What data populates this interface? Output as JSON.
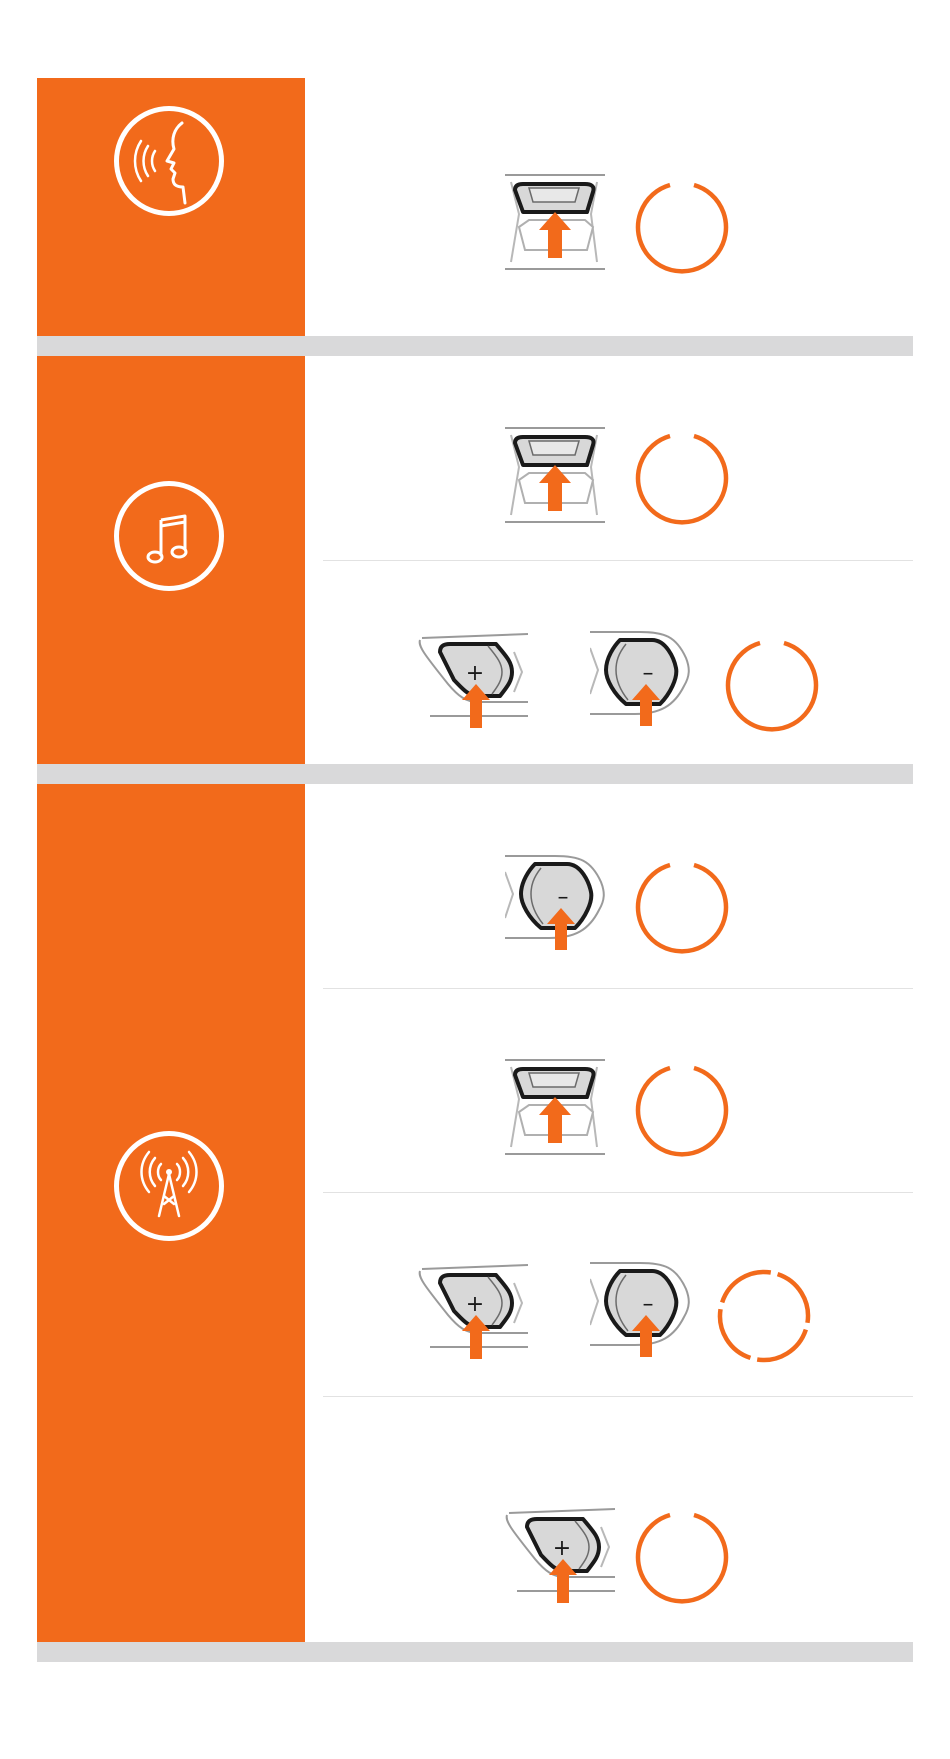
{
  "colors": {
    "accent": "#f26a1b",
    "separator": "#d9d9da",
    "divider": "#e2e2e2",
    "button_fill": "#d8d8d8",
    "button_stroke": "#1a1a1a"
  },
  "sections": [
    {
      "icon": "voice-command-icon",
      "rows": [
        {
          "buttons": [
            {
              "type": "center",
              "glyph": ""
            }
          ],
          "indicator": "solid-ring"
        }
      ]
    },
    {
      "icon": "music-note-icon",
      "rows": [
        {
          "buttons": [
            {
              "type": "center",
              "glyph": ""
            }
          ],
          "indicator": "solid-ring"
        },
        {
          "buttons": [
            {
              "type": "plus",
              "glyph": "+"
            },
            {
              "type": "minus",
              "glyph": "–"
            }
          ],
          "indicator": "solid-ring"
        }
      ]
    },
    {
      "icon": "radio-tower-icon",
      "rows": [
        {
          "buttons": [
            {
              "type": "minus",
              "glyph": "–"
            }
          ],
          "indicator": "solid-ring"
        },
        {
          "buttons": [
            {
              "type": "center",
              "glyph": ""
            }
          ],
          "indicator": "solid-ring"
        },
        {
          "buttons": [
            {
              "type": "plus",
              "glyph": "+"
            },
            {
              "type": "minus",
              "glyph": "–"
            }
          ],
          "indicator": "dashed-ring"
        },
        {
          "buttons": [
            {
              "type": "plus",
              "glyph": "+"
            }
          ],
          "indicator": "solid-ring"
        }
      ]
    }
  ]
}
